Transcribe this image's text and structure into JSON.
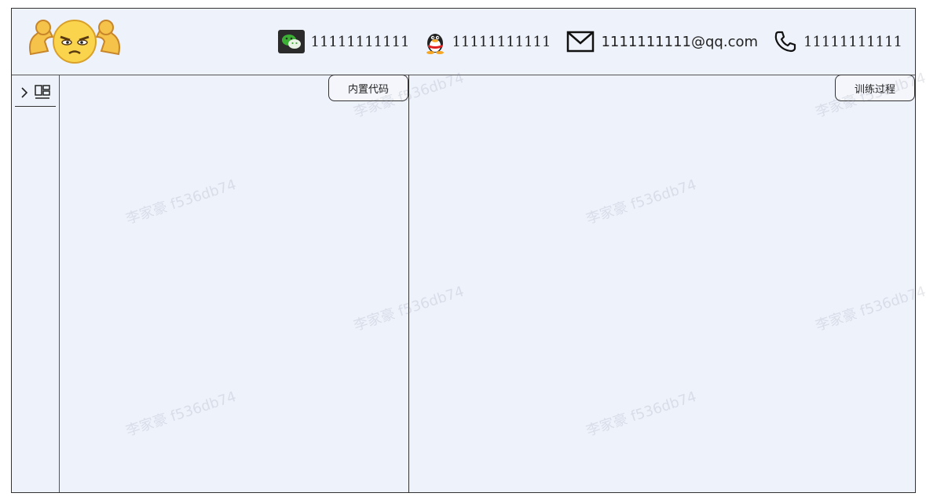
{
  "header": {
    "contacts": {
      "wechat": "11111111111",
      "qq": "11111111111",
      "email": "1111111111@qq.com",
      "phone": "11111111111"
    }
  },
  "panels": {
    "left_button": "内置代码",
    "right_button": "训练过程"
  },
  "watermark": "李家豪 f536db74",
  "icons": {
    "wechat": "wechat-icon",
    "qq": "qq-icon",
    "email": "mail-icon",
    "phone": "phone-icon",
    "expand": "chevron-right-icon",
    "layout": "layout-icon"
  },
  "colors": {
    "background": "#eef2fb",
    "wechat_green": "#3cb034",
    "border": "#333333"
  }
}
